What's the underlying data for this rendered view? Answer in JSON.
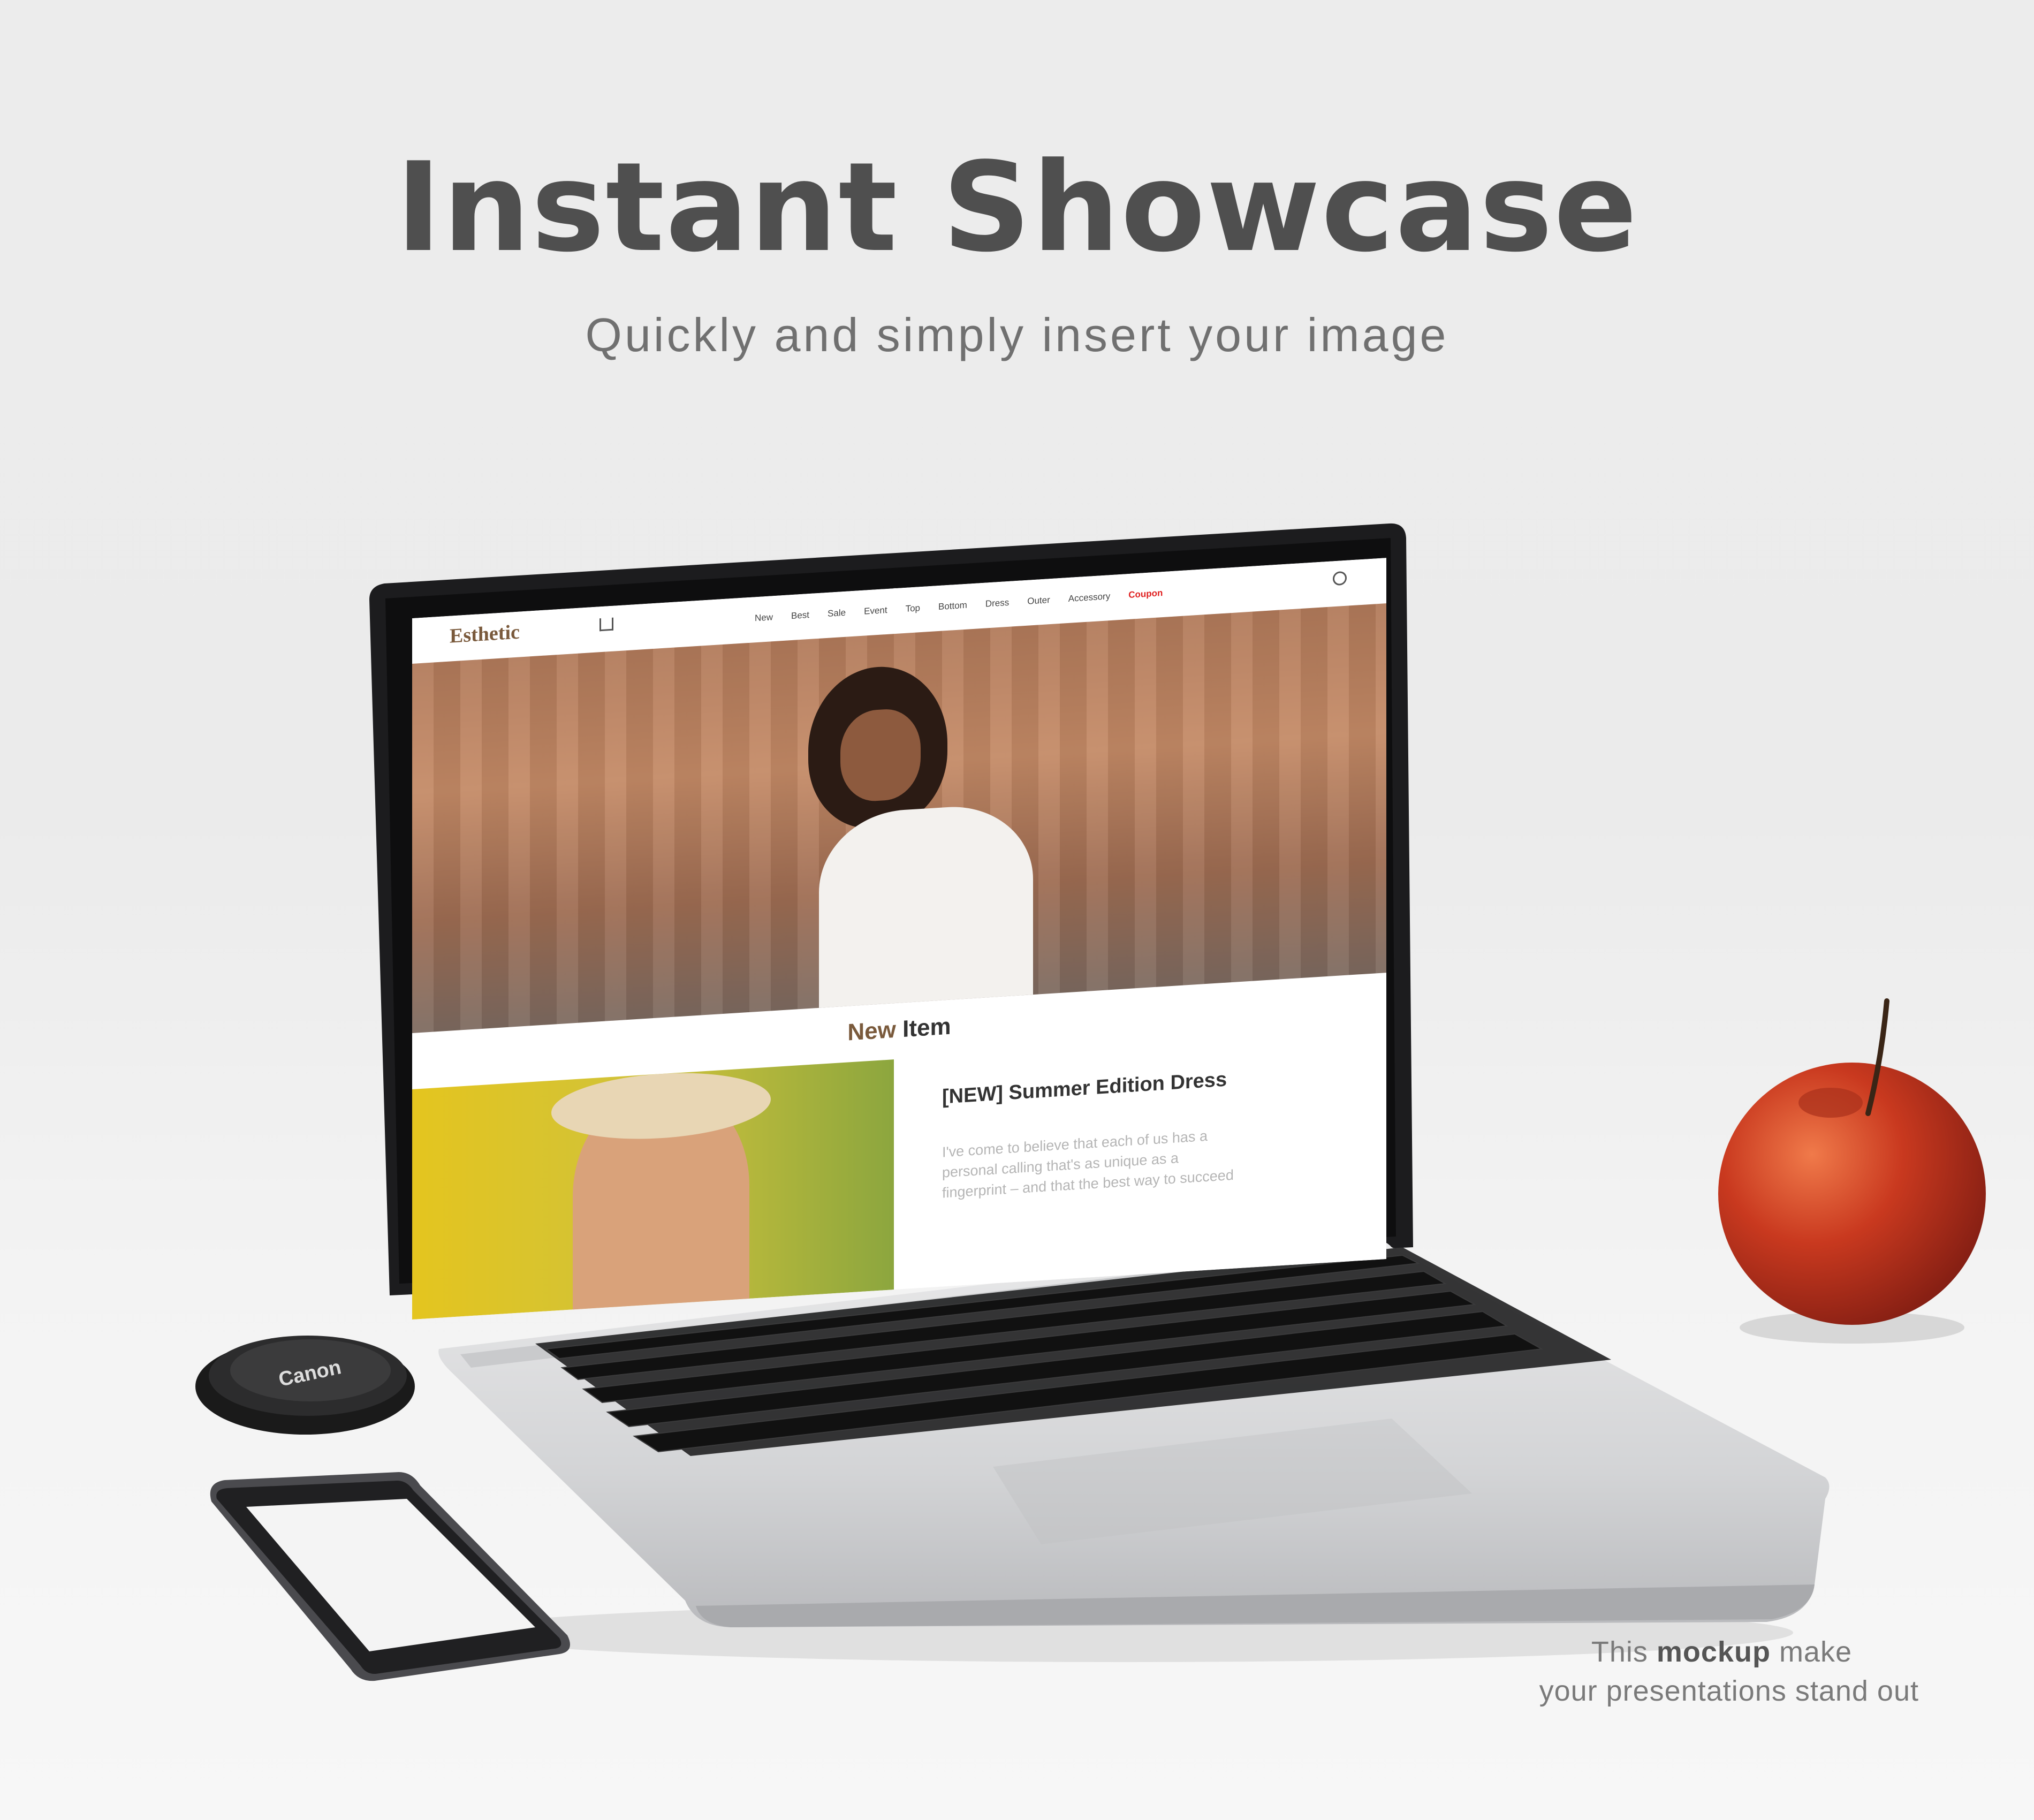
{
  "headline": "Instant Showcase",
  "subline": "Quickly and simply insert your image",
  "caption": {
    "line1_pre": "This ",
    "line1_bold": "mockup",
    "line1_post": " make",
    "line2": "your presentations  stand out"
  },
  "website": {
    "logo": "Esthetic",
    "nav": [
      "New",
      "Best",
      "Sale",
      "Event",
      "Top",
      "Bottom",
      "Dress",
      "Outer",
      "Accessory",
      "Coupon"
    ],
    "coupon_color": "#e02020",
    "section_title_accent": "New",
    "section_title_rest": " Item",
    "product_title": "[NEW] Summer Edition Dress",
    "product_text": "I've come to believe that each of us has a personal calling that's as unique as a fingerprint – and that the best way to succeed"
  },
  "lens_cap_text": "Canon",
  "colors": {
    "headline": "#4f4f4f",
    "brand_brown": "#7a5a3c",
    "apple_red": "#c23a22"
  }
}
